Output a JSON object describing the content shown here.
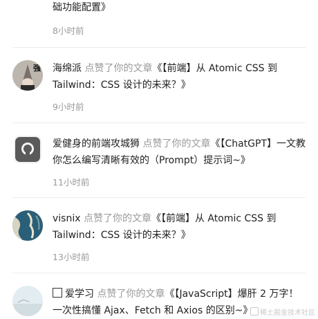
{
  "items": [
    {
      "user": "",
      "action": "",
      "article": "础功能配置》",
      "time": "8小时前",
      "avatar_icon": "avatar-partial"
    },
    {
      "user": "海绵派",
      "action": "点赞了你的文章",
      "article": "《【前端】从 Atomic CSS 到 Tailwind：CSS 设计的未来？》",
      "time": "9小时前",
      "avatar_icon": "avatar-wizard",
      "avatar_text": "强"
    },
    {
      "user": "爱健身的前端攻城狮",
      "action": "点赞了你的文章",
      "article": "《【ChatGPT】一文教你怎么编写清晰有效的（Prompt）提示词~》",
      "time": "11小时前",
      "avatar_icon": "avatar-github"
    },
    {
      "user": "visnix",
      "action": "点赞了你的文章",
      "article": "《【前端】从 Atomic CSS 到 Tailwind：CSS 设计的未来？》",
      "time": "13小时前",
      "avatar_icon": "avatar-earth"
    },
    {
      "user": "爱学习",
      "action": "点赞了你的文章",
      "article": "《【JavaScript】爆肝 2 万字！一次性搞懂 Ajax、Fetch 和 Axios 的区别~》",
      "time": "",
      "avatar_icon": "avatar-sky"
    }
  ],
  "watermark": "稀土掘金技术社区",
  "colors": {
    "muted": "#9a9a9a",
    "divider": "#ececec"
  }
}
